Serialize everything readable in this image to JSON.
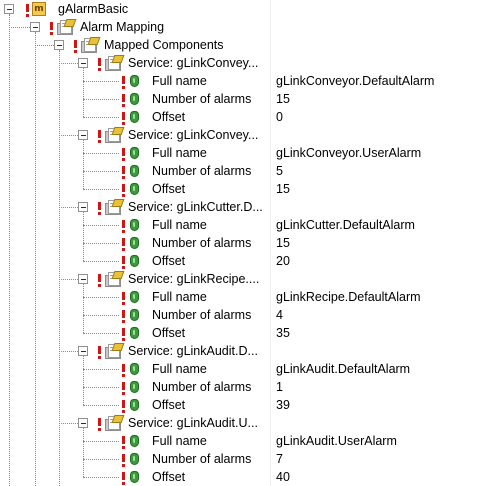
{
  "root": {
    "label": "gAlarmBasic",
    "icon": "module-m-icon",
    "icon_letter": "m"
  },
  "mapping": {
    "label": "Alarm Mapping",
    "icon": "component-folder-icon"
  },
  "mapped": {
    "label": "Mapped Components",
    "icon": "component-folder-icon"
  },
  "services": [
    {
      "label": "Service: gLinkConvey...",
      "props": [
        {
          "name": "Full name",
          "value": "gLinkConveyor.DefaultAlarm"
        },
        {
          "name": "Number of alarms",
          "value": "15"
        },
        {
          "name": "Offset",
          "value": "0"
        }
      ]
    },
    {
      "label": "Service: gLinkConvey...",
      "props": [
        {
          "name": "Full name",
          "value": "gLinkConveyor.UserAlarm"
        },
        {
          "name": "Number of alarms",
          "value": "5"
        },
        {
          "name": "Offset",
          "value": "15"
        }
      ]
    },
    {
      "label": "Service: gLinkCutter.D...",
      "props": [
        {
          "name": "Full name",
          "value": "gLinkCutter.DefaultAlarm"
        },
        {
          "name": "Number of alarms",
          "value": "15"
        },
        {
          "name": "Offset",
          "value": "20"
        }
      ]
    },
    {
      "label": "Service: gLinkRecipe....",
      "props": [
        {
          "name": "Full name",
          "value": "gLinkRecipe.DefaultAlarm"
        },
        {
          "name": "Number of alarms",
          "value": "4"
        },
        {
          "name": "Offset",
          "value": "35"
        }
      ]
    },
    {
      "label": "Service: gLinkAudit.D...",
      "props": [
        {
          "name": "Full name",
          "value": "gLinkAudit.DefaultAlarm"
        },
        {
          "name": "Number of alarms",
          "value": "1"
        },
        {
          "name": "Offset",
          "value": "39"
        }
      ]
    },
    {
      "label": "Service: gLinkAudit.U...",
      "props": [
        {
          "name": "Full name",
          "value": "gLinkAudit.UserAlarm"
        },
        {
          "name": "Number of alarms",
          "value": "7"
        },
        {
          "name": "Offset",
          "value": "40"
        }
      ]
    }
  ],
  "colors": {
    "error_marker": "#d11414",
    "leaf_icon": "#3d9b3d",
    "tree_lines": "#8a8a8a"
  }
}
